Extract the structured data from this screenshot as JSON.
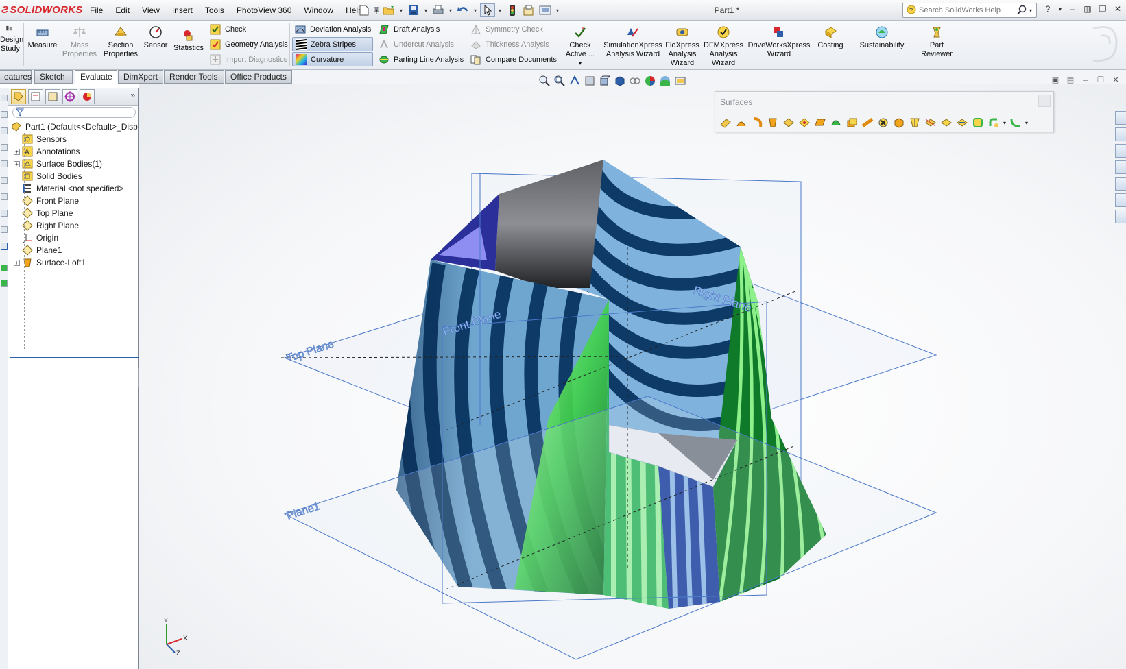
{
  "app": {
    "brand": "SOLIDWORKS",
    "document_title": "Part1 *"
  },
  "menu": [
    "File",
    "Edit",
    "View",
    "Insert",
    "Tools",
    "PhotoView 360",
    "Window",
    "Help"
  ],
  "search": {
    "placeholder": "Search SolidWorks Help"
  },
  "ribbon": {
    "design_study": "Design Study",
    "measure": "Measure",
    "mass_properties": "Mass Properties",
    "section_properties": "Section Properties",
    "sensor": "Sensor",
    "statistics": "Statistics",
    "check": "Check",
    "geometry_analysis": "Geometry Analysis",
    "import_diagnostics": "Import Diagnostics",
    "deviation_analysis": "Deviation Analysis",
    "zebra_stripes": "Zebra Stripes",
    "curvature": "Curvature",
    "draft_analysis": "Draft Analysis",
    "undercut_analysis": "Undercut Analysis",
    "parting_line_analysis": "Parting Line Analysis",
    "symmetry_check": "Symmetry Check",
    "thickness_analysis": "Thickness Analysis",
    "compare_documents": "Compare Documents",
    "check_active": "Check Active ...",
    "simulationxpress": "SimulationXpress Analysis Wizard",
    "floxpress": "FloXpress Analysis Wizard",
    "dfmxpress": "DFMXpress Analysis Wizard",
    "driveworksxpress": "DriveWorksXpress Wizard",
    "costing": "Costing",
    "sustainability": "Sustainability",
    "part_reviewer": "Part Reviewer"
  },
  "tabs": [
    "eatures",
    "Sketch",
    "Evaluate",
    "DimXpert",
    "Render Tools",
    "Office Products"
  ],
  "active_tab": "Evaluate",
  "tree": {
    "root": "Part1  (Default<<Default>_Disp",
    "items": [
      {
        "label": "Sensors",
        "expandable": false
      },
      {
        "label": "Annotations",
        "expandable": true
      },
      {
        "label": "Surface Bodies(1)",
        "expandable": true
      },
      {
        "label": "Solid Bodies",
        "expandable": false
      },
      {
        "label": "Material <not specified>",
        "expandable": false
      },
      {
        "label": "Front Plane",
        "expandable": false
      },
      {
        "label": "Top Plane",
        "expandable": false
      },
      {
        "label": "Right Plane",
        "expandable": false
      },
      {
        "label": "Origin",
        "expandable": false
      },
      {
        "label": "Plane1",
        "expandable": false
      },
      {
        "label": "Surface-Loft1",
        "expandable": true
      }
    ]
  },
  "viewport": {
    "plane_labels": {
      "front": "Front Plane",
      "top": "Top Plane",
      "right": "Right Plane",
      "plane1": "Plane1"
    },
    "surfaces_toolbar_title": "Surfaces",
    "triad": {
      "x": "X",
      "y": "Y",
      "z": "Z"
    }
  },
  "colors": {
    "brand_red": "#d8282e",
    "plane_blue": "#4b78c8",
    "stripe_dark": "#0d3a66",
    "stripe_light": "#7fb2dc",
    "stripe_green": "#6fe36a"
  }
}
